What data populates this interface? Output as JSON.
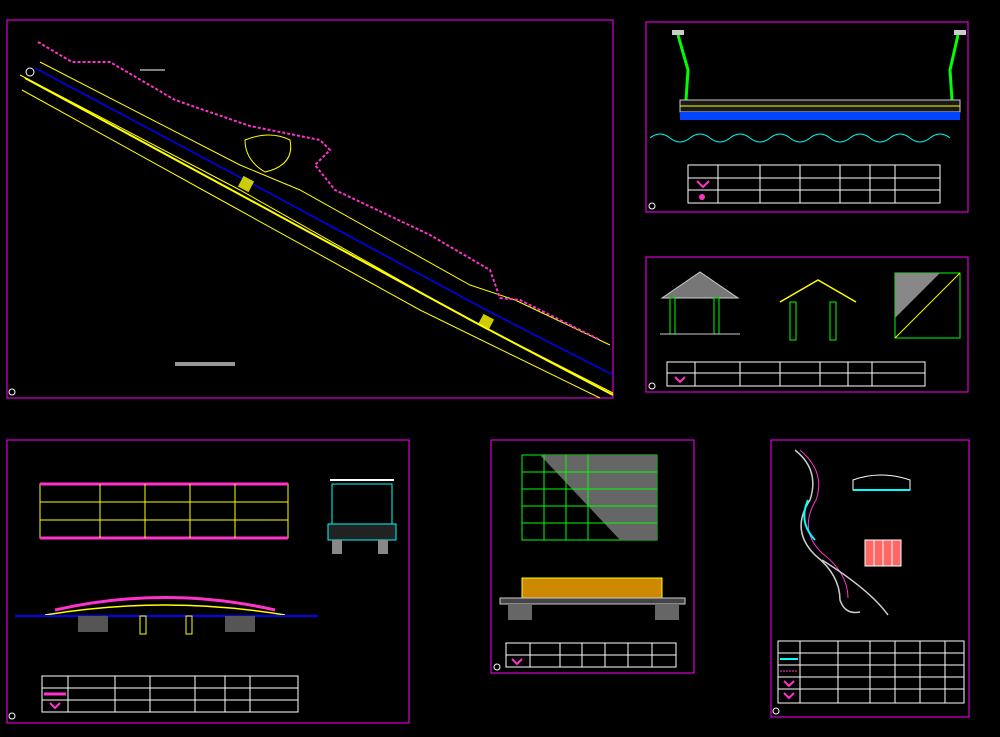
{
  "sheet": {
    "background": "#000000",
    "colors": {
      "frame": "#ff00ff",
      "road": "#ffff00",
      "centerline": "#0000ff",
      "pink": "#ff33cc",
      "cyan": "#00ffff",
      "green": "#00ff00",
      "white": "#ffffff",
      "orange": "#ff9900",
      "red": "#ff0000",
      "gray": "#888888"
    }
  },
  "panels": [
    {
      "id": "panel-road-plan"
    },
    {
      "id": "panel-bridge-lamps"
    },
    {
      "id": "panel-pavilion"
    },
    {
      "id": "panel-footbridge"
    },
    {
      "id": "panel-pergola"
    },
    {
      "id": "panel-stream-path"
    }
  ],
  "legend_tables": [
    {
      "id": "table-bridge-lamps",
      "rows": 3,
      "cols": 6
    },
    {
      "id": "table-pavilion",
      "rows": 2,
      "cols": 6
    },
    {
      "id": "table-footbridge",
      "rows": 3,
      "cols": 6
    },
    {
      "id": "table-pergola",
      "rows": 2,
      "cols": 6
    },
    {
      "id": "table-stream",
      "rows": 5,
      "cols": 6
    }
  ]
}
